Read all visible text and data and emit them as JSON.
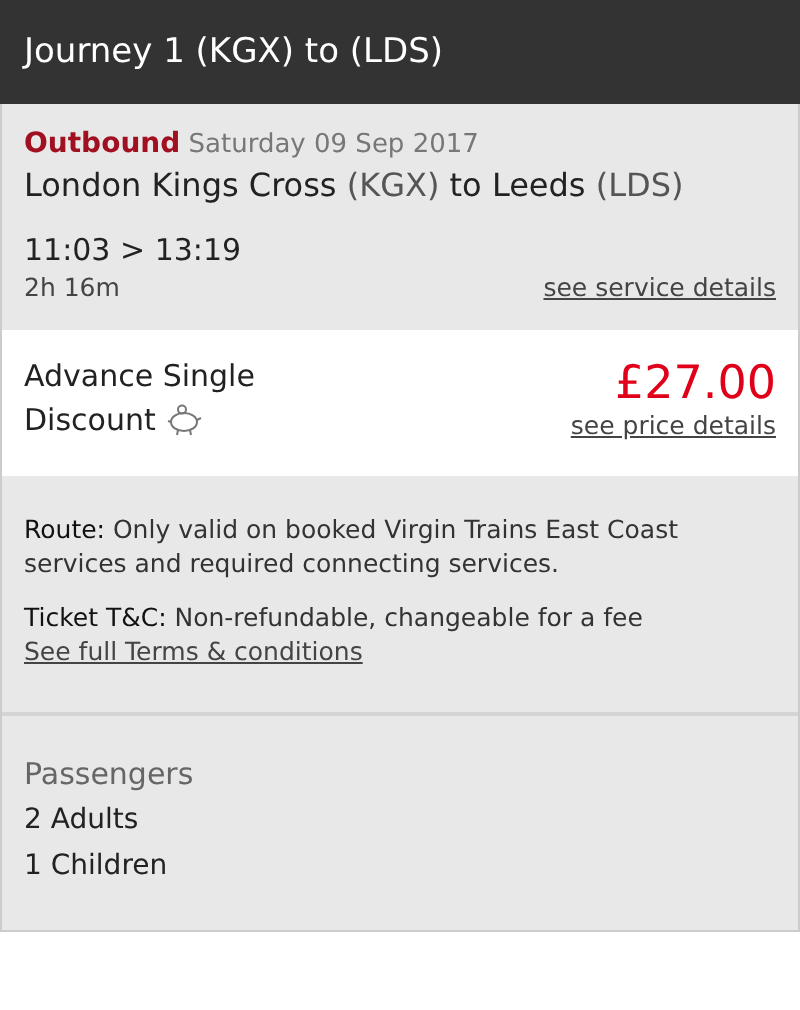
{
  "header": {
    "title": "Journey 1 (KGX) to (LDS)"
  },
  "journey": {
    "direction": "Outbound",
    "date": "Saturday 09 Sep 2017",
    "from": "London Kings Cross",
    "from_code": "(KGX)",
    "to_word": "to",
    "to": "Leeds",
    "to_code": "(LDS)",
    "times": "11:03 > 13:19",
    "duration": "2h 16m",
    "link": "see service details"
  },
  "fare": {
    "name": "Advance Single",
    "type": "Discount",
    "price": "£27.00",
    "link": "see price details"
  },
  "conditions": {
    "route": "**Route:** Only valid on booked Virgin Trains East Coast services and required connecting services.",
    "ticket": "**Ticket T&C:** Non-refundable, changeable for a fee",
    "link": "See full Terms & conditions"
  },
  "passengers": {
    "title": "Passengers",
    "items": [
      {
        "count": "2",
        "label": "Adults"
      },
      {
        "count": "1",
        "label": "Children"
      }
    ]
  }
}
